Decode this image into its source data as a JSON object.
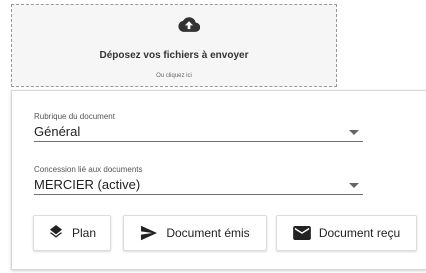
{
  "upload": {
    "title": "Déposez vos fichiers à envoyer",
    "subtitle": "Ou cliquez ici",
    "icon": "cloud-upload-icon"
  },
  "form": {
    "rubrique": {
      "label": "Rubrique du document",
      "value": "Général"
    },
    "concession": {
      "label": "Concession lié aux documents",
      "value": "MERCIER (active)"
    }
  },
  "actions": {
    "plan": {
      "label": "Plan",
      "icon": "layers-icon"
    },
    "emis": {
      "label": "Document émis",
      "icon": "send-icon"
    },
    "recu": {
      "label": "Document reçu",
      "icon": "mail-icon"
    }
  }
}
